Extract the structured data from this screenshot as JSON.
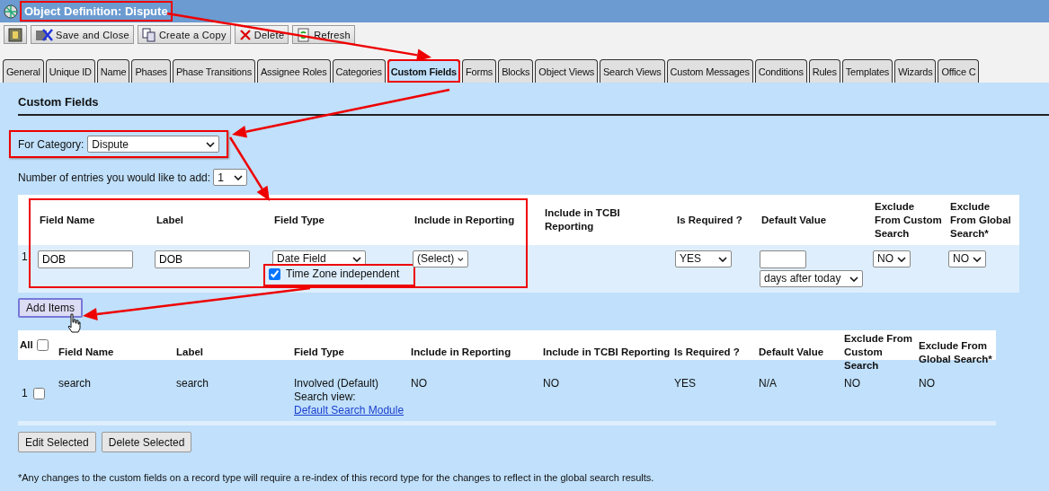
{
  "window": {
    "title": "Object Definition: Dispute"
  },
  "toolbar": [
    {
      "kind": "help"
    },
    {
      "kind": "save",
      "label": "Save and Close"
    },
    {
      "kind": "copy",
      "label": "Create a Copy"
    },
    {
      "kind": "delete",
      "label": "Delete"
    },
    {
      "kind": "refresh",
      "label": "Refresh"
    }
  ],
  "tabs": [
    {
      "label": "General",
      "selected": false
    },
    {
      "label": "Unique ID",
      "selected": false
    },
    {
      "label": "Name",
      "selected": false
    },
    {
      "label": "Phases",
      "selected": false
    },
    {
      "label": "Phase Transitions",
      "selected": false
    },
    {
      "label": "Assignee Roles",
      "selected": false
    },
    {
      "label": "Categories",
      "selected": false
    },
    {
      "label": "Custom Fields",
      "selected": true
    },
    {
      "label": "Forms",
      "selected": false
    },
    {
      "label": "Blocks",
      "selected": false
    },
    {
      "label": "Object Views",
      "selected": false
    },
    {
      "label": "Search Views",
      "selected": false
    },
    {
      "label": "Custom Messages",
      "selected": false
    },
    {
      "label": "Conditions",
      "selected": false
    },
    {
      "label": "Rules",
      "selected": false
    },
    {
      "label": "Templates",
      "selected": false
    },
    {
      "label": "Wizards",
      "selected": false
    },
    {
      "label": "Office C",
      "selected": false
    }
  ],
  "section_title": "Custom Fields",
  "category": {
    "label": "For Category:",
    "value": "Dispute"
  },
  "entries": {
    "label": "Number of entries you would like to add:",
    "value": "1"
  },
  "new_fields": {
    "columns": [
      "Field Name",
      "Label",
      "Field Type",
      "Include in Reporting",
      "Include in TCBI Reporting",
      "Is Required ?",
      "Default Value",
      "Exclude From Custom Search",
      "Exclude From Global Search*"
    ],
    "rows": [
      {
        "number": "1",
        "field_name": "DOB",
        "label": "DOB",
        "field_type": "Date Field",
        "time_zone": {
          "label": "Time Zone independent",
          "checked": true
        },
        "include_in_reporting": "(Select)",
        "is_required": "YES",
        "default_unit": "days after today",
        "exclude_custom": "NO",
        "exclude_global": "NO"
      }
    ]
  },
  "add_button": "Add Items",
  "existing_fields": {
    "all_label": "All",
    "all_checked": false,
    "columns": [
      "Field Name",
      "Label",
      "Field Type",
      "Include in Reporting",
      "Include in TCBI Reporting",
      "Is Required ?",
      "Default Value",
      "Exclude From Custom Search",
      "Exclude From Global Search*"
    ],
    "rows": [
      {
        "number": "1",
        "selected": false,
        "field_name": "search",
        "label": "search",
        "field_type": "Involved (Default)",
        "search_view_label": "Search view:",
        "search_view_link": "Default Search Module",
        "include_in_reporting": "NO",
        "include_in_tcbi": "NO",
        "is_required": "YES",
        "default_value": "N/A",
        "exclude_custom": "NO",
        "exclude_global": "NO"
      }
    ]
  },
  "buttons": [
    "Edit Selected",
    "Delete Selected"
  ],
  "footnote": "*Any changes to the custom fields on a record type will require a re-index of this record type for the changes to reflect in the global search results."
}
